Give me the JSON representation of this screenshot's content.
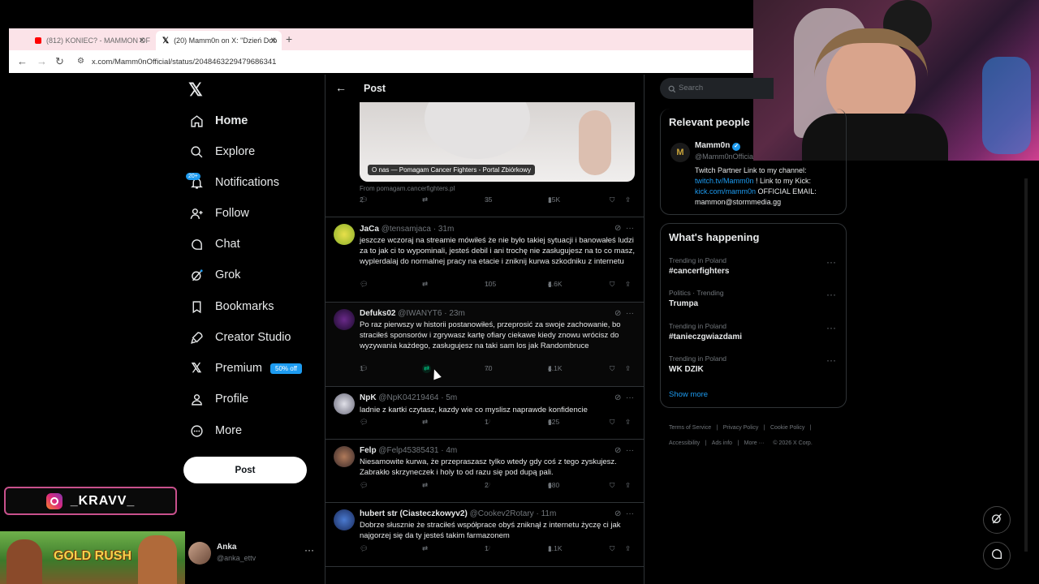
{
  "browser": {
    "tabs": [
      {
        "label": "(812) KONIEC? - MAMMON OF"
      },
      {
        "label": "(20) Mamm0n on X: \"Dzień Dob"
      }
    ],
    "url": "x.com/Mamm0nOfficial/status/2048463229479686341"
  },
  "sidebar": {
    "notifications_badge": "20+",
    "items": [
      {
        "label": "Home",
        "icon": "home-icon"
      },
      {
        "label": "Explore",
        "icon": "search-icon"
      },
      {
        "label": "Notifications",
        "icon": "bell-icon"
      },
      {
        "label": "Follow",
        "icon": "follow-icon"
      },
      {
        "label": "Chat",
        "icon": "chat-icon"
      },
      {
        "label": "Grok",
        "icon": "grok-icon"
      },
      {
        "label": "Bookmarks",
        "icon": "bookmark-icon"
      },
      {
        "label": "Creator Studio",
        "icon": "rocket-icon"
      },
      {
        "label": "Premium",
        "icon": "x-logo-icon"
      },
      {
        "label": "Profile",
        "icon": "profile-icon"
      },
      {
        "label": "More",
        "icon": "more-icon"
      }
    ],
    "premium_badge": "50% off",
    "post_button": "Post",
    "account": {
      "name": "Anka",
      "handle": "@anka_ettv"
    }
  },
  "overlay": {
    "instagram_handle": "_KRAVV_",
    "game_banner": "GOLD RUSH"
  },
  "header": {
    "title": "Post"
  },
  "link_card": {
    "caption": "O nas — Pomagam Cancer Fighters - Portal Zbiórkowy",
    "source": "From pomagam.cancerfighters.pl",
    "stats": {
      "replies": "2",
      "likes": "35",
      "views": "15K"
    }
  },
  "replies": [
    {
      "name": "JaCa",
      "handle": "@tensamjaca",
      "time": "· 31m",
      "text": "jeszcze wczoraj na streamie mówiłeś że nie było takiej sytuacji i banowałeś ludzi za to jak ci to wypominali, jesteś debil i ani trochę nie zasługujesz na to co masz, wyplerdalaj do normalnej pracy na etacie i zniknij kurwa szkodniku z internetu",
      "replies": "",
      "likes": "105",
      "views": "4.6K"
    },
    {
      "name": "Defuks02",
      "handle": "@IWANYT6",
      "time": "· 23m",
      "text": "Po raz pierwszy w historii postanowiłeś, przeprosić za swoje zachowanie, bo straciłeś sponsorów i zgrywasz kartę ofiary ciekawe kiedy znowu wrócisz do wyzywania każdego, zasługujesz na taki sam los jak Randombruce",
      "replies": "1",
      "likes": "70",
      "views": "4.1K"
    },
    {
      "name": "NpK",
      "handle": "@NpK04219464",
      "time": "· 5m",
      "text": "ladnie z kartki czytasz, kazdy wie co myslisz naprawde konfidencie",
      "replies": "",
      "likes": "1",
      "views": "625"
    },
    {
      "name": "Felp",
      "handle": "@Felp45385431",
      "time": "· 4m",
      "text": "Niesamowite kurwa, że przepraszasz tylko wtedy gdy coś z tego zyskujesz. Zabrakło skrzyneczek i holy to od razu się pod dupą pali.",
      "replies": "",
      "likes": "2",
      "views": "680"
    },
    {
      "name": "hubert str (Ciasteczkowyv2)",
      "handle": "@Cookev2Rotary",
      "time": "· 11m",
      "text": "Dobrze słusznie że straciłeś współprace obyś zniknął z internetu życzę ci jak najgorzej się da ty jesteś takim farmazonem",
      "replies": "",
      "likes": "1",
      "views": "1.1K"
    }
  ],
  "right": {
    "search_placeholder": "Search",
    "relevant": {
      "title": "Relevant people",
      "name": "Mamm0n",
      "handle": "@Mamm0nOfficia",
      "bio_1": "Twitch Partner Link to my channel:",
      "bio_link1": "twitch.tv/Mamm0n",
      "bio_2": " ! Link to my Kick:",
      "bio_link2": "kick.com/mamm0n",
      "bio_3": " OFFICIAL EMAIL:",
      "bio_4": "mammon@stormmedia.gg"
    },
    "happening": {
      "title": "What's happening",
      "trends": [
        {
          "category": "Trending in Poland",
          "name": "#cancerfighters"
        },
        {
          "category": "Politics · Trending",
          "name": "Trumpa"
        },
        {
          "category": "Trending in Poland",
          "name": "#tanieczgwiazdami"
        },
        {
          "category": "Trending in Poland",
          "name": "WK DZIK"
        }
      ],
      "show_more": "Show more"
    },
    "footer": [
      "Terms of Service",
      "Privacy Policy",
      "Cookie Policy",
      "Accessibility",
      "Ads info",
      "More ···",
      "© 2026 X Corp."
    ]
  },
  "colors": {
    "accent": "#1d9bf0",
    "retweet_active": "#00ba7c",
    "tab_bg": "#fbe3e8"
  }
}
